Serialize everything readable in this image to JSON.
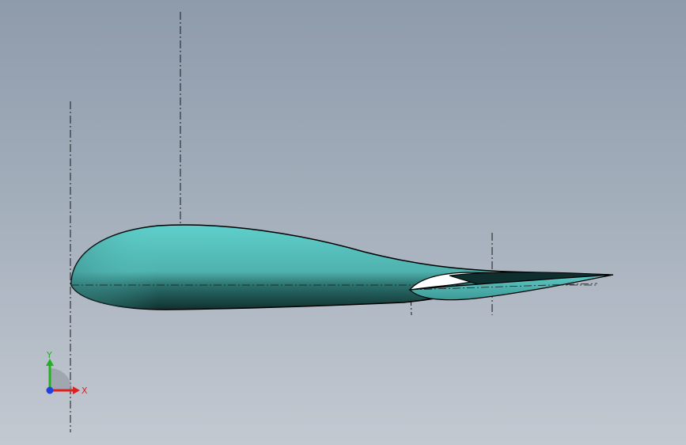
{
  "viewport": {
    "background_top": "#8e9bab",
    "background_bottom": "#c3c9d1"
  },
  "model": {
    "name": "airfoil-with-trailing-flap",
    "surface_color": "#5fc6c3",
    "shadow_color": "#163c3a",
    "edge_color": "#000000"
  },
  "triad": {
    "x_label": "X",
    "y_label": "Y",
    "x_color": "#e02020",
    "y_color": "#20b020",
    "z_color": "#2040e0"
  }
}
